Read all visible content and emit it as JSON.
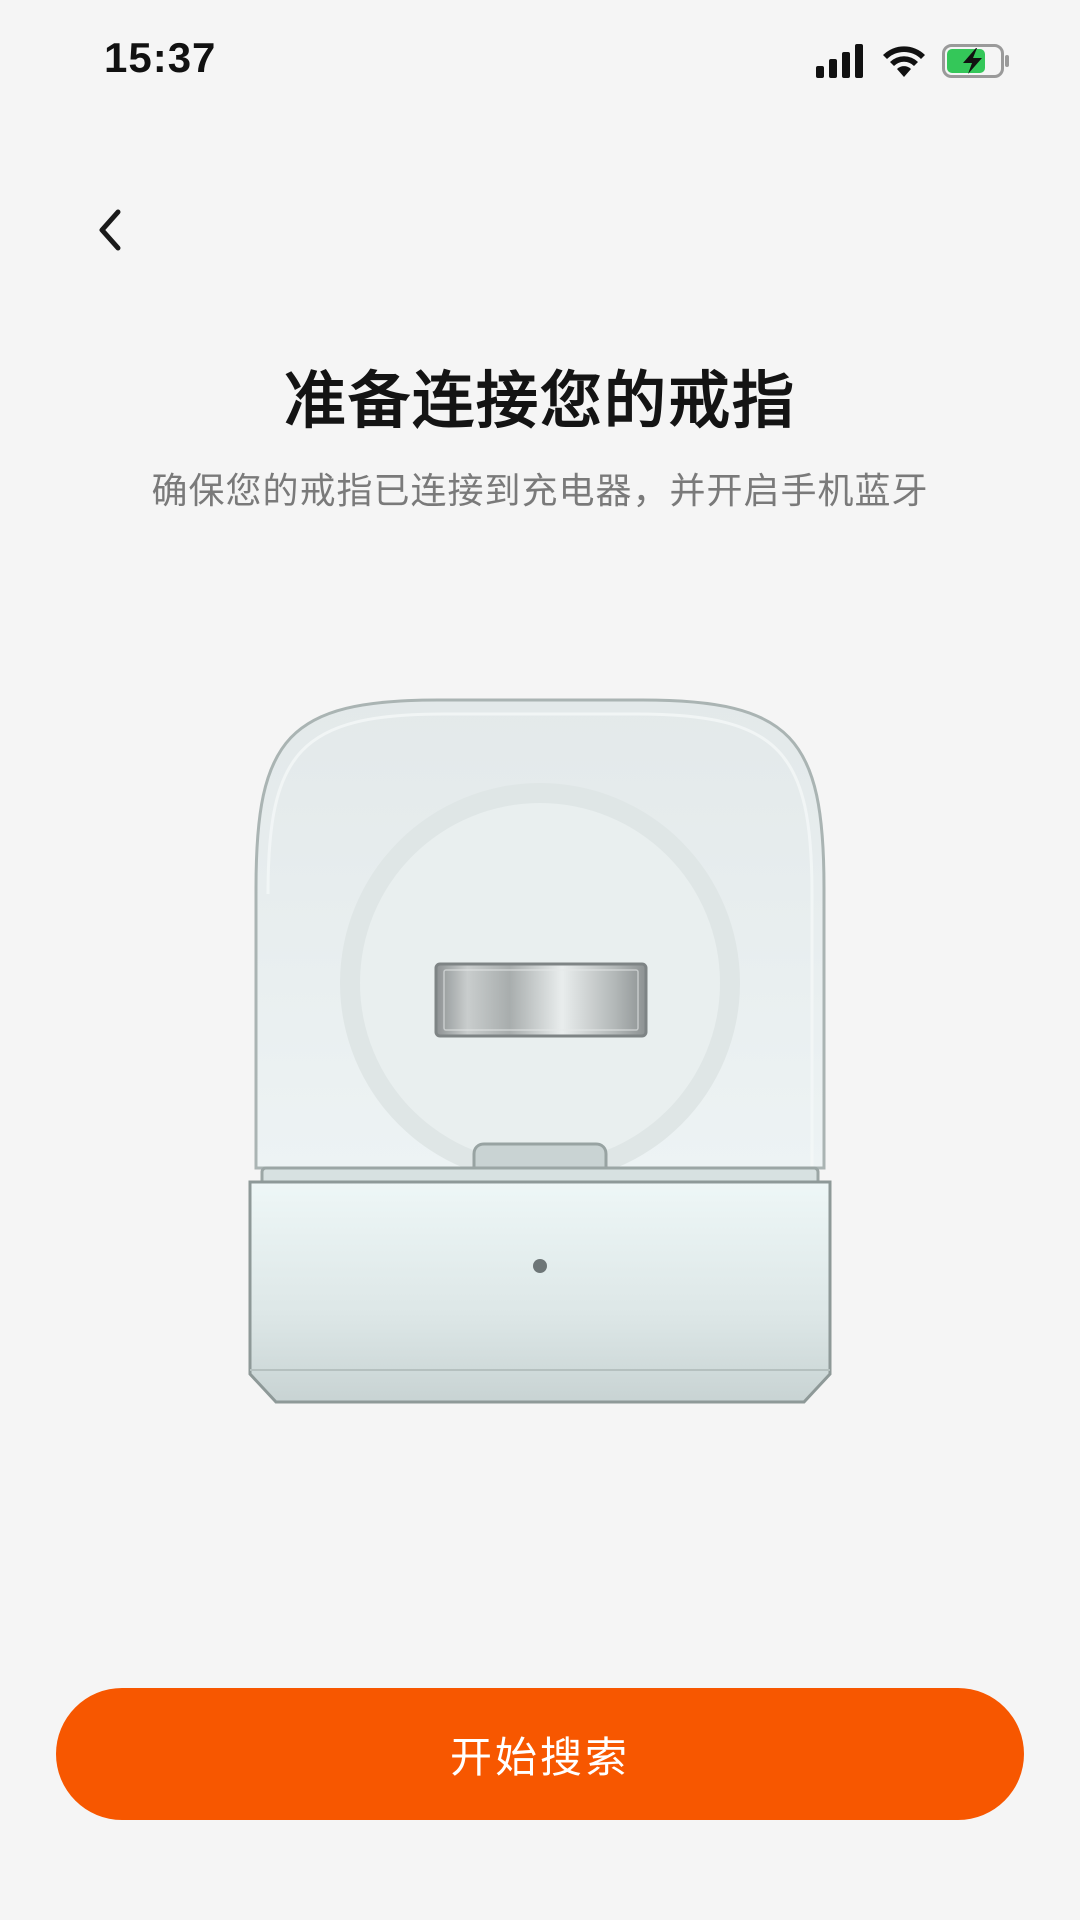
{
  "status_bar": {
    "time": "15:37",
    "icons": [
      "cellular-signal-icon",
      "wifi-icon",
      "battery-charging-icon"
    ],
    "battery_color": "#34c759"
  },
  "nav": {
    "back_icon": "chevron-left-icon"
  },
  "header": {
    "title": "准备连接您的戒指",
    "subtitle": "确保您的戒指已连接到充电器，并开启手机蓝牙"
  },
  "illustration": {
    "subject": "ring-on-charger"
  },
  "actions": {
    "start_search_label": "开始搜索",
    "accent_color": "#f75700"
  }
}
